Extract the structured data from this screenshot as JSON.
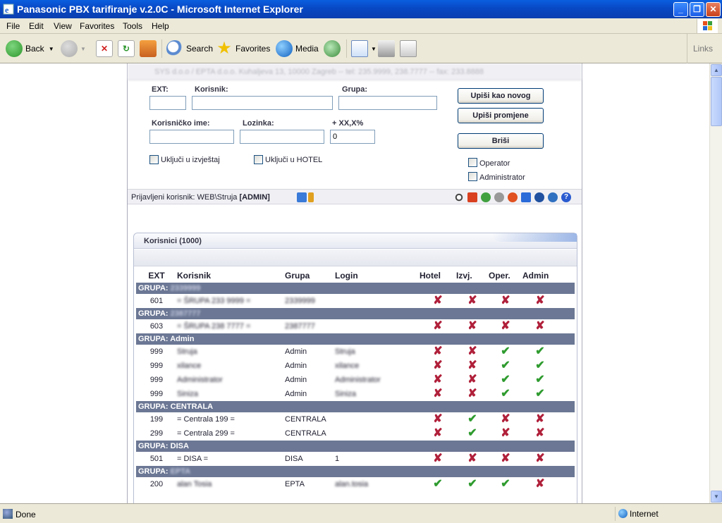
{
  "window": {
    "title": "Panasonic PBX tarifiranje v.2.0C - Microsoft Internet Explorer"
  },
  "menu": [
    "File",
    "Edit",
    "View",
    "Favorites",
    "Tools",
    "Help"
  ],
  "toolbar": {
    "back": "Back",
    "search": "Search",
    "favorites": "Favorites",
    "media": "Media",
    "links": "Links"
  },
  "status": {
    "text": "Done",
    "zone": "Internet"
  },
  "page": {
    "header": "SYS d.o.o / EPTA d.o.o. Kuhaljeva 13, 10000 Zagreb -- tel: 235.9999, 238.7777 -- fax: 233.8888",
    "form": {
      "ext_label": "EXT:",
      "korisnik_label": "Korisnik:",
      "grupa_label": "Grupa:",
      "username_label": "Korisničko ime:",
      "password_label": "Lozinka:",
      "percent_label": "+ XX,X%",
      "percent_value": "0",
      "btn_new": "Upiši kao novog",
      "btn_save": "Upiši promjene",
      "btn_delete": "Briši",
      "chk_report": "Uključi u izvještaj",
      "chk_hotel": "Uključi u HOTEL",
      "chk_operator": "Operator",
      "chk_admin": "Administrator"
    },
    "login": {
      "prefix": "Prijavljeni korisnik: WEB\\Struja",
      "role": "[ADMIN]"
    },
    "panel": {
      "title": "Korisnici (1000)",
      "columns": [
        "EXT",
        "Korisnik",
        "Grupa",
        "Login",
        "Hotel",
        "Izvj.",
        "Oper.",
        "Admin"
      ]
    }
  },
  "icons": {
    "x": "✘",
    "ok": "✔"
  },
  "groups": [
    {
      "label": "GRUPA: 2339999",
      "blur": true,
      "rows": [
        {
          "ext": "601",
          "name": "= ŠRUPA 233 9999 =",
          "group": "2339999",
          "login": "",
          "blur": true,
          "hotel": false,
          "izvj": false,
          "oper": false,
          "admin": false
        }
      ]
    },
    {
      "label": "GRUPA: 2387777",
      "blur": true,
      "rows": [
        {
          "ext": "603",
          "name": "= ŠRUPA 238 7777 =",
          "group": "2387777",
          "login": "",
          "blur": true,
          "hotel": false,
          "izvj": false,
          "oper": false,
          "admin": false
        }
      ]
    },
    {
      "label": "GRUPA: Admin",
      "blur": false,
      "rows": [
        {
          "ext": "999",
          "name": "Struja",
          "group": "Admin",
          "login": "Struja",
          "blur": true,
          "hotel": false,
          "izvj": false,
          "oper": true,
          "admin": true
        },
        {
          "ext": "999",
          "name": "xilance",
          "group": "Admin",
          "login": "xilance",
          "blur": true,
          "hotel": false,
          "izvj": false,
          "oper": true,
          "admin": true
        },
        {
          "ext": "999",
          "name": "Administrator",
          "group": "Admin",
          "login": "Administrator",
          "blur": true,
          "hotel": false,
          "izvj": false,
          "oper": true,
          "admin": true
        },
        {
          "ext": "999",
          "name": "Siniza",
          "group": "Admin",
          "login": "Siniza",
          "blur": true,
          "hotel": false,
          "izvj": false,
          "oper": true,
          "admin": true
        }
      ]
    },
    {
      "label": "GRUPA: CENTRALA",
      "blur": false,
      "rows": [
        {
          "ext": "199",
          "name": "= Centrala 199 =",
          "group": "CENTRALA",
          "login": "",
          "blur": false,
          "hotel": false,
          "izvj": true,
          "oper": false,
          "admin": false
        },
        {
          "ext": "299",
          "name": "= Centrala 299 =",
          "group": "CENTRALA",
          "login": "",
          "blur": false,
          "hotel": false,
          "izvj": true,
          "oper": false,
          "admin": false
        }
      ]
    },
    {
      "label": "GRUPA: DISA",
      "blur": false,
      "rows": [
        {
          "ext": "501",
          "name": "= DISA =",
          "group": "DISA",
          "login": "1",
          "blur": false,
          "hotel": false,
          "izvj": false,
          "oper": false,
          "admin": false
        }
      ]
    },
    {
      "label": "GRUPA: EPTA",
      "blur": true,
      "rows": [
        {
          "ext": "200",
          "name": "alan Tosia",
          "group": "EPTA",
          "login": "alan.tosia",
          "blur": true,
          "hotel": true,
          "izvj": true,
          "oper": true,
          "admin": false
        }
      ]
    }
  ]
}
